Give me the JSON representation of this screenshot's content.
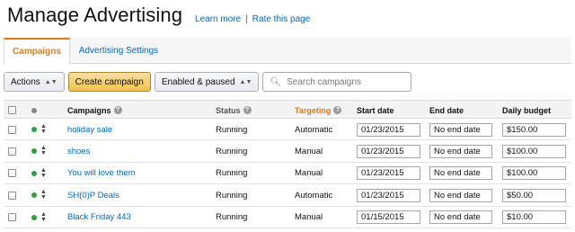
{
  "header": {
    "title": "Manage Advertising",
    "learn_more": "Learn more",
    "separator": "|",
    "rate_page": "Rate this page"
  },
  "tabs": [
    {
      "label": "Campaigns",
      "active": true
    },
    {
      "label": "Advertising Settings",
      "active": false
    }
  ],
  "toolbar": {
    "actions_label": "Actions",
    "create_label": "Create campaign",
    "filter_label": "Enabled & paused",
    "search_placeholder": "Search campaigns"
  },
  "table": {
    "columns": {
      "campaigns": "Campaigns",
      "status": "Status",
      "targeting": "Targeting",
      "start_date": "Start date",
      "end_date": "End date",
      "daily_budget": "Daily budget"
    },
    "rows": [
      {
        "name": "holiday sale",
        "status": "Running",
        "targeting": "Automatic",
        "start": "01/23/2015",
        "end": "No end date",
        "budget": "$150.00"
      },
      {
        "name": "shoes",
        "status": "Running",
        "targeting": "Manual",
        "start": "01/23/2015",
        "end": "No end date",
        "budget": "$100.00"
      },
      {
        "name": "You will love them",
        "status": "Running",
        "targeting": "Manual",
        "start": "01/23/2015",
        "end": "No end date",
        "budget": "$100.00"
      },
      {
        "name": "SH(0)P Deals",
        "status": "Running",
        "targeting": "Automatic",
        "start": "01/23/2015",
        "end": "No end date",
        "budget": "$50.00"
      },
      {
        "name": "Black Friday 443",
        "status": "Running",
        "targeting": "Manual",
        "start": "01/15/2015",
        "end": "No end date",
        "budget": "$10.00"
      }
    ]
  },
  "colors": {
    "accent_orange": "#e47911",
    "link_blue": "#0066c0",
    "status_green": "#2ea043",
    "primary_button": "#f0c14b"
  },
  "icons": {
    "help": "question-circle-icon",
    "search": "magnifier-icon",
    "caret": "updown-caret-icon",
    "status": "status-dot-icon"
  }
}
